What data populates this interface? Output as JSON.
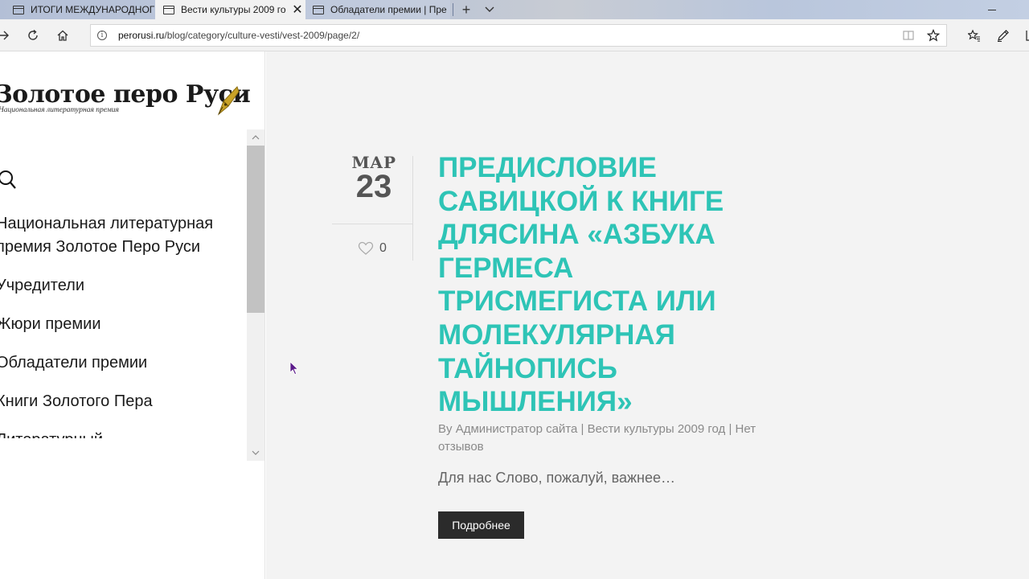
{
  "browser": {
    "tabs": [
      {
        "label": "ИТОГИ МЕЖДУНАРОДНОГ",
        "active": false
      },
      {
        "label": "Вести культуры 2009 го",
        "active": true
      },
      {
        "label": "Обладатели премии | Пре",
        "active": false
      }
    ],
    "new_tab_glyph": "+",
    "close_glyph": "✕",
    "address": {
      "domain": "perorusi.ru",
      "path": "/blog/category/culture-vesti/vest-2009/page/2/"
    }
  },
  "sidebar": {
    "logo_title": "Золотое перо Руси",
    "logo_subtitle": "Национальная литературная премия",
    "menu": [
      {
        "label": "Национальная литературная премия Золотое Перо Руси"
      },
      {
        "label": "Учредители"
      },
      {
        "label": "Жюри премии"
      },
      {
        "label": "Обладатели премии"
      },
      {
        "label": "Книги Золотого Пера"
      },
      {
        "label": "Литературный"
      }
    ]
  },
  "post": {
    "month": "МАР",
    "day": "23",
    "likes": "0",
    "title": "Предисловие Савицкой к книге Длясина «Азбука Гермеса Трисмегиста или Молекулярная тайнопись мышления»",
    "meta_by": "By",
    "meta_author": "Администратор сайта",
    "meta_sep": "|",
    "meta_category": "Вести культуры 2009 год",
    "meta_comments": "Нет отзывов",
    "excerpt": "Для нас Слово, пожалуй, важнее…",
    "more_label": "Подробнее"
  },
  "colors": {
    "accent": "#2ec4b6",
    "button": "#2b2b2b",
    "main_bg": "#f3f3f3"
  },
  "icons": [
    "tab-page-icon",
    "back-arrow-icon",
    "refresh-icon",
    "home-icon",
    "info-icon",
    "reading-view-icon",
    "star-icon",
    "favorites-icon",
    "pen-icon",
    "search-icon",
    "heart-icon",
    "chevron-up-icon",
    "chevron-down-icon",
    "cursor-icon"
  ]
}
